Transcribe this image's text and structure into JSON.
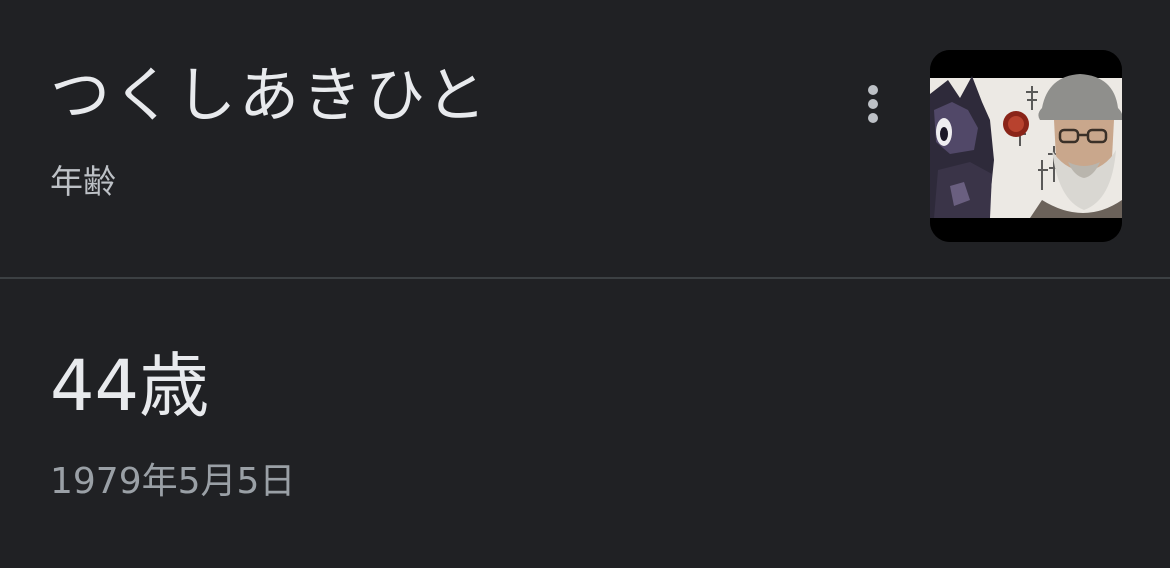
{
  "knowledge_panel": {
    "title": "つくしあきひと",
    "attribute_label": "年齢",
    "more_options_icon": "more-vert-icon",
    "thumbnail_alt": "つくしあきひと",
    "age_value": "44歳",
    "birth_date": "1979年5月5日"
  },
  "colors": {
    "background": "#202124",
    "primary_text": "#e8eaed",
    "secondary_text": "#bdc1c6",
    "tertiary_text": "#9aa0a6",
    "divider": "#3c4043"
  }
}
